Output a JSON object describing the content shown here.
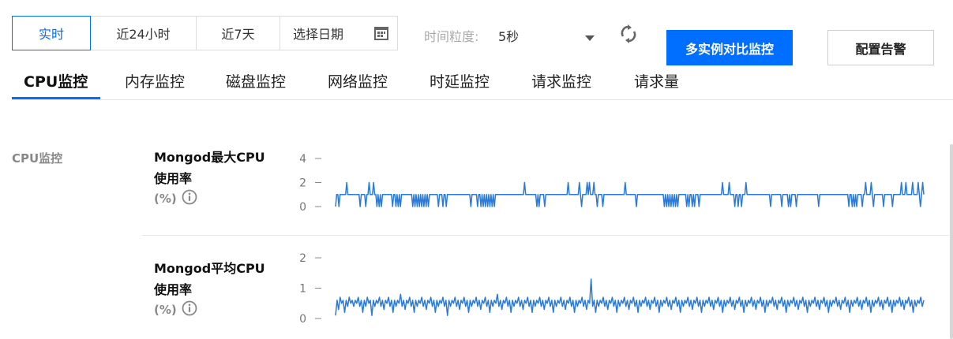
{
  "toolbar": {
    "ranges": [
      {
        "label": "实时",
        "active": true
      },
      {
        "label": "近24小时",
        "active": false
      },
      {
        "label": "近7天",
        "active": false
      }
    ],
    "date_picker_label": "选择日期",
    "granularity_label": "时间粒度:",
    "granularity_value": "5秒",
    "compare_button": "多实例对比监控",
    "alarm_button": "配置告警"
  },
  "tabs": [
    {
      "label": "CPU监控",
      "active": true
    },
    {
      "label": "内存监控",
      "active": false
    },
    {
      "label": "磁盘监控",
      "active": false
    },
    {
      "label": "网络监控",
      "active": false
    },
    {
      "label": "时延监控",
      "active": false
    },
    {
      "label": "请求监控",
      "active": false
    },
    {
      "label": "请求量",
      "active": false
    }
  ],
  "section_label": "CPU监控",
  "colors": {
    "accent": "#006eff",
    "series": "#2b7bd6"
  },
  "metrics": [
    {
      "title_line1": "Mongod最大CPU",
      "title_line2": "使用率",
      "unit": "(%)"
    },
    {
      "title_line1": "Mongod平均CPU",
      "title_line2": "使用率",
      "unit": "(%)"
    }
  ],
  "chart_data": [
    {
      "type": "line",
      "ylim": [
        0,
        4
      ],
      "yticks": [
        0,
        2,
        4
      ],
      "series": [
        {
          "values": [
            0,
            1,
            1,
            0,
            1,
            1,
            1,
            1,
            1,
            1,
            2,
            1,
            1,
            1,
            1,
            1,
            1,
            1,
            1,
            1,
            1,
            1,
            0,
            1,
            1,
            1,
            1,
            0,
            1,
            1,
            2,
            1,
            1,
            1,
            2,
            1,
            1,
            0,
            1,
            0,
            1,
            0,
            1,
            1,
            1,
            1,
            1,
            1,
            1,
            1,
            1,
            0,
            1,
            1,
            0,
            1,
            0,
            1,
            0,
            1,
            1,
            1,
            1,
            1,
            1,
            1,
            1,
            1,
            1,
            0,
            1,
            0,
            1,
            0,
            1,
            0,
            1,
            0,
            1,
            0,
            1,
            0,
            1,
            0,
            1,
            1,
            1,
            1,
            1,
            1,
            1,
            1,
            0,
            1,
            1,
            1,
            0,
            1,
            1,
            0,
            1,
            1,
            1,
            1,
            1,
            1,
            1,
            1,
            1,
            1,
            1,
            1,
            1,
            1,
            1,
            1,
            1,
            1,
            1,
            1,
            1,
            0,
            1,
            1,
            1,
            1,
            1,
            0,
            1,
            1,
            0,
            1,
            0,
            1,
            0,
            1,
            0,
            1,
            0,
            1,
            0,
            1,
            0,
            1,
            1,
            1,
            1,
            1,
            1,
            1,
            1,
            1,
            1,
            1,
            1,
            1,
            1,
            1,
            1,
            1,
            1,
            1,
            1,
            1,
            1,
            1,
            1,
            1,
            1,
            2,
            1,
            1,
            1,
            1,
            1,
            1,
            1,
            1,
            1,
            1,
            0,
            1,
            0,
            1,
            1,
            1,
            1,
            0,
            1,
            1,
            1,
            1,
            1,
            1,
            1,
            1,
            1,
            1,
            1,
            1,
            1,
            1,
            1,
            1,
            1,
            1,
            1,
            1,
            2,
            1,
            1,
            1,
            1,
            1,
            1,
            1,
            1,
            1,
            2,
            1,
            0,
            1,
            1,
            1,
            1,
            2,
            1,
            2,
            1,
            1,
            1,
            2,
            1,
            1,
            0,
            1,
            1,
            1,
            1,
            0,
            1,
            1,
            1,
            1,
            1,
            1,
            1,
            1,
            1,
            1,
            1,
            1,
            1,
            1,
            1,
            1,
            1,
            1,
            1,
            2,
            1,
            1,
            1,
            1,
            1,
            1,
            1,
            1,
            1,
            0,
            1,
            1,
            1,
            1,
            1,
            1,
            1,
            1,
            1,
            1,
            1,
            1,
            1,
            1,
            1,
            1,
            1,
            1,
            1,
            1,
            1,
            1,
            1,
            1,
            0,
            1,
            0,
            1,
            0,
            1,
            0,
            1,
            0,
            1,
            0,
            1,
            0,
            1,
            1,
            1,
            1,
            1,
            1,
            1,
            0,
            1,
            0,
            1,
            1,
            0,
            1,
            0,
            1,
            1,
            1,
            0,
            1,
            1,
            1,
            1,
            1,
            1,
            1,
            1,
            1,
            1,
            1,
            1,
            1,
            1,
            1,
            1,
            1,
            1,
            1,
            1,
            2,
            1,
            1,
            1,
            1,
            1,
            2,
            1,
            1,
            1,
            1,
            0,
            1,
            1,
            0,
            1,
            1,
            0,
            1,
            1,
            1,
            2,
            1,
            1,
            1,
            1,
            1,
            1,
            1,
            1,
            1,
            1,
            1,
            1,
            1,
            1,
            1,
            1,
            1,
            1,
            1,
            1,
            1,
            0,
            1,
            1,
            1,
            1,
            1,
            1,
            1,
            1,
            1,
            0,
            1,
            1,
            1,
            1,
            1,
            0,
            1,
            0,
            1,
            1,
            1,
            1,
            0,
            1,
            1,
            1,
            1,
            1,
            1,
            1,
            1,
            1,
            1,
            1,
            1,
            1,
            1,
            1,
            1,
            1,
            1,
            1,
            0,
            1,
            1,
            1,
            1,
            1,
            1,
            1,
            1,
            1,
            1,
            1,
            1,
            1,
            1,
            1,
            1,
            1,
            1,
            1,
            1,
            1,
            1,
            1,
            1,
            1,
            1,
            0,
            1,
            1,
            0,
            1,
            0,
            1,
            0,
            1,
            1,
            1,
            1,
            0,
            1,
            1,
            2,
            1,
            1,
            1,
            1,
            2,
            1,
            0,
            1,
            1,
            1,
            1,
            1,
            1,
            1,
            1,
            0,
            1,
            1,
            1,
            1,
            1,
            1,
            1,
            0,
            1,
            1,
            1,
            1,
            1,
            1,
            1,
            2,
            1,
            1,
            1,
            2,
            1,
            1,
            1,
            1,
            1,
            2,
            1,
            1,
            1,
            1,
            2,
            1,
            0,
            1,
            2,
            1
          ]
        }
      ]
    },
    {
      "type": "line",
      "ylim": [
        0,
        2
      ],
      "yticks": [
        0,
        1,
        2
      ],
      "series": [
        {
          "values": [
            0.1,
            0.6,
            0.3,
            0.7,
            0.5,
            0.6,
            0.2,
            0.6,
            0.4,
            0.7,
            0.5,
            0.6,
            0.4,
            0.6,
            0.5,
            0.7,
            0.4,
            0.6,
            0.2,
            0.6,
            0.4,
            0.7,
            0.5,
            0.6,
            0.1,
            0.6,
            0.4,
            0.6,
            0.5,
            0.7,
            0.4,
            0.6,
            0.3,
            0.6,
            0.5,
            0.7,
            0.4,
            0.6,
            0.2,
            0.6,
            0.4,
            0.6,
            0.5,
            0.8,
            0.4,
            0.6,
            0.3,
            0.6,
            0.5,
            0.7,
            0.4,
            0.6,
            0.2,
            0.6,
            0.4,
            0.6,
            0.5,
            0.7,
            0.4,
            0.6,
            0.3,
            0.6,
            0.5,
            0.7,
            0.4,
            0.6,
            0.2,
            0.6,
            0.4,
            0.6,
            0.5,
            0.7,
            0.4,
            0.6,
            0.1,
            0.6,
            0.4,
            0.6,
            0.5,
            0.7,
            0.4,
            0.6,
            0.3,
            0.6,
            0.5,
            0.7,
            0.4,
            0.6,
            0.2,
            0.6,
            0.4,
            0.6,
            0.5,
            0.7,
            0.4,
            0.6,
            0.3,
            0.6,
            0.5,
            0.7,
            0.4,
            0.6,
            0.2,
            0.6,
            0.4,
            0.6,
            0.5,
            0.8,
            0.4,
            0.6,
            0.3,
            0.6,
            0.5,
            0.7,
            0.4,
            0.6,
            0.2,
            0.6,
            0.4,
            0.6,
            0.5,
            0.7,
            0.4,
            0.6,
            0.3,
            0.6,
            0.5,
            0.7,
            0.4,
            0.6,
            0.2,
            0.6,
            0.4,
            0.6,
            0.5,
            0.7,
            0.4,
            0.6,
            0.3,
            0.6,
            0.5,
            0.7,
            0.4,
            0.6,
            0.2,
            0.6,
            0.4,
            0.6,
            0.5,
            0.7,
            0.4,
            0.6,
            0.3,
            0.6,
            0.5,
            0.7,
            0.4,
            0.6,
            0.2,
            0.6,
            0.4,
            0.6,
            0.5,
            0.7,
            0.4,
            0.6,
            0.3,
            0.6,
            0.5,
            1.3,
            0.4,
            0.6,
            0.2,
            0.6,
            0.4,
            0.6,
            0.5,
            0.7,
            0.4,
            0.6,
            0.3,
            0.6,
            0.5,
            0.7,
            0.4,
            0.6,
            0.2,
            0.6,
            0.4,
            0.6,
            0.5,
            0.7,
            0.4,
            0.6,
            0.3,
            0.6,
            0.5,
            0.7,
            0.4,
            0.6,
            0.2,
            0.6,
            0.4,
            0.6,
            0.5,
            0.7,
            0.4,
            0.6,
            0.3,
            0.6,
            0.5,
            0.7,
            0.4,
            0.6,
            0.2,
            0.6,
            0.4,
            0.6,
            0.5,
            0.7,
            0.4,
            0.6,
            0.3,
            0.6,
            0.5,
            0.7,
            0.4,
            0.6,
            0.2,
            0.6,
            0.4,
            0.6,
            0.5,
            0.7,
            0.4,
            0.6,
            0.3,
            0.6,
            0.5,
            0.7,
            0.4,
            0.6,
            0.2,
            0.6,
            0.4,
            0.6,
            0.5,
            0.7,
            0.4,
            0.6,
            0.3,
            0.6,
            0.5,
            0.7,
            0.4,
            0.6,
            0.2,
            0.6,
            0.4,
            0.6,
            0.5,
            0.7,
            0.4,
            0.6,
            0.3,
            0.6,
            0.5,
            0.7,
            0.4,
            0.6,
            0.2,
            0.6,
            0.4,
            0.6,
            0.5,
            0.7,
            0.4,
            0.6,
            0.3,
            0.6,
            0.5,
            0.7,
            0.4,
            0.6,
            0.2,
            0.6,
            0.4,
            0.6,
            0.5,
            0.7,
            0.4,
            0.6,
            0.3,
            0.6,
            0.5,
            0.7,
            0.4,
            0.6,
            0.2,
            0.6,
            0.4,
            0.6,
            0.5,
            0.7,
            0.4,
            0.6,
            0.3,
            0.6,
            0.5,
            0.7,
            0.4,
            0.6,
            0.2,
            0.6,
            0.4,
            0.6,
            0.5,
            0.7,
            0.4,
            0.6,
            0.3,
            0.6,
            0.5,
            0.7,
            0.4,
            0.6,
            0.2,
            0.6,
            0.4,
            0.6,
            0.5,
            0.7,
            0.4,
            0.6,
            0.3,
            0.6,
            0.5,
            0.7,
            0.4,
            0.6,
            0.2,
            0.6,
            0.4,
            0.6,
            0.5,
            0.7,
            0.4,
            0.6,
            0.3,
            0.6,
            0.5,
            0.7,
            0.4,
            0.6,
            0.2,
            0.6,
            0.4,
            0.6,
            0.5,
            0.7,
            0.4,
            0.6,
            0.3,
            0.6,
            0.5,
            0.7,
            0.4,
            0.6,
            0.2,
            0.6,
            0.4,
            0.6,
            0.5,
            0.7,
            0.4,
            0.6,
            0.3,
            0.6,
            0.5,
            0.7,
            0.4,
            0.6,
            0.2,
            0.6,
            0.4,
            0.6,
            0.5,
            0.7,
            0.4,
            0.6
          ]
        }
      ]
    }
  ]
}
